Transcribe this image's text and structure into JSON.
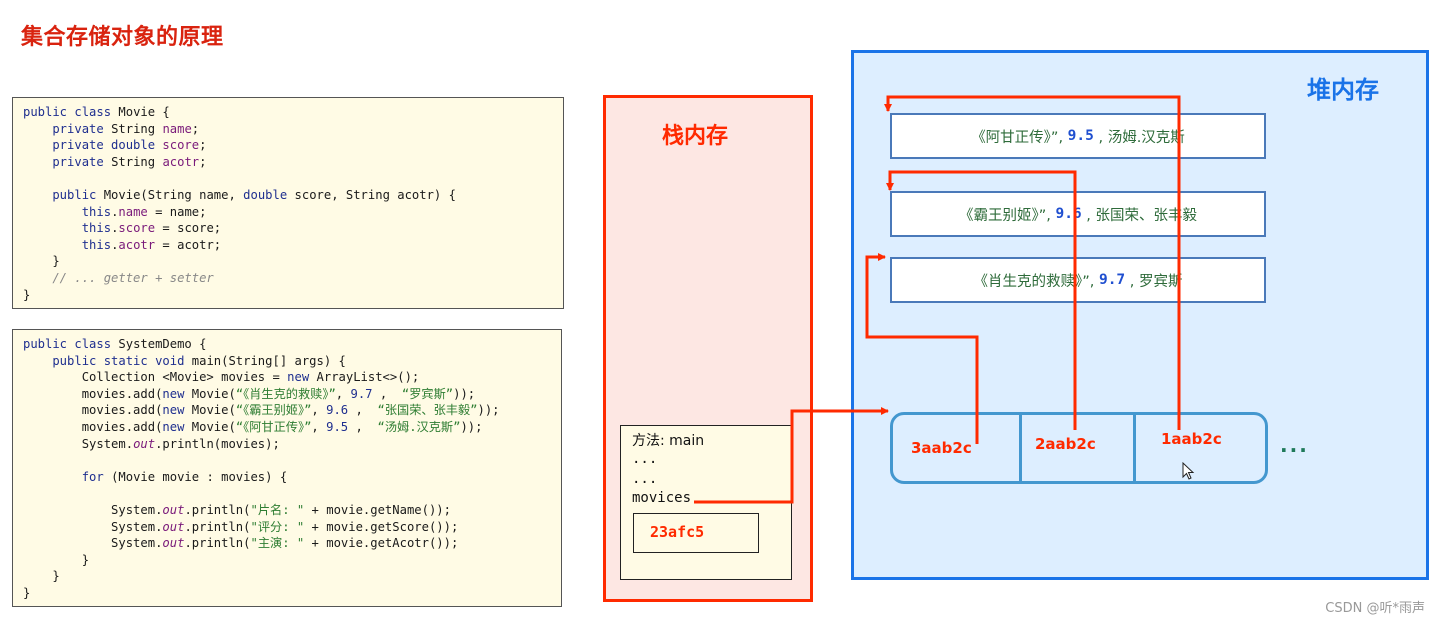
{
  "title": "集合存储对象的原理",
  "code_movie": [
    [
      {
        "t": "public class ",
        "c": "kw"
      },
      {
        "t": "Movie {",
        "c": ""
      }
    ],
    [
      {
        "t": "    private ",
        "c": "kw"
      },
      {
        "t": "String ",
        "c": ""
      },
      {
        "t": "name",
        "c": "fld"
      },
      {
        "t": ";",
        "c": ""
      }
    ],
    [
      {
        "t": "    private double ",
        "c": "kw"
      },
      {
        "t": "score",
        "c": "fld"
      },
      {
        "t": ";",
        "c": ""
      }
    ],
    [
      {
        "t": "    private ",
        "c": "kw"
      },
      {
        "t": "String ",
        "c": ""
      },
      {
        "t": "acotr",
        "c": "fld"
      },
      {
        "t": ";",
        "c": ""
      }
    ],
    [
      {
        "t": "",
        "c": ""
      }
    ],
    [
      {
        "t": "    public ",
        "c": "kw"
      },
      {
        "t": "Movie(String name, ",
        "c": ""
      },
      {
        "t": "double ",
        "c": "kw"
      },
      {
        "t": "score, String acotr) {",
        "c": ""
      }
    ],
    [
      {
        "t": "        this",
        "c": "kw"
      },
      {
        "t": ".",
        "c": ""
      },
      {
        "t": "name",
        "c": "fld"
      },
      {
        "t": " = name;",
        "c": ""
      }
    ],
    [
      {
        "t": "        this",
        "c": "kw"
      },
      {
        "t": ".",
        "c": ""
      },
      {
        "t": "score",
        "c": "fld"
      },
      {
        "t": " = score;",
        "c": ""
      }
    ],
    [
      {
        "t": "        this",
        "c": "kw"
      },
      {
        "t": ".",
        "c": ""
      },
      {
        "t": "acotr",
        "c": "fld"
      },
      {
        "t": " = acotr;",
        "c": ""
      }
    ],
    [
      {
        "t": "    }",
        "c": ""
      }
    ],
    [
      {
        "t": "    // ... getter + setter",
        "c": "cmt"
      }
    ],
    [
      {
        "t": "}",
        "c": ""
      }
    ]
  ],
  "code_demo": [
    [
      {
        "t": "public class ",
        "c": "kw"
      },
      {
        "t": "SystemDemo {",
        "c": ""
      }
    ],
    [
      {
        "t": "    public static void ",
        "c": "kw"
      },
      {
        "t": "main(String[] args) {",
        "c": ""
      }
    ],
    [
      {
        "t": "        Collection <Movie> movies = ",
        "c": ""
      },
      {
        "t": "new ",
        "c": "kw"
      },
      {
        "t": "ArrayList<>();",
        "c": ""
      }
    ],
    [
      {
        "t": "        movies.add(",
        "c": ""
      },
      {
        "t": "new ",
        "c": "kw"
      },
      {
        "t": "Movie(",
        "c": ""
      },
      {
        "t": "“《肖生克的救赎》”",
        "c": "str"
      },
      {
        "t": ", ",
        "c": ""
      },
      {
        "t": "9.7",
        "c": "num"
      },
      {
        "t": " ,  ",
        "c": ""
      },
      {
        "t": "“罗宾斯”",
        "c": "str"
      },
      {
        "t": "));",
        "c": ""
      }
    ],
    [
      {
        "t": "        movies.add(",
        "c": ""
      },
      {
        "t": "new ",
        "c": "kw"
      },
      {
        "t": "Movie(",
        "c": ""
      },
      {
        "t": "“《霸王别姬》”",
        "c": "str"
      },
      {
        "t": ", ",
        "c": ""
      },
      {
        "t": "9.6",
        "c": "num"
      },
      {
        "t": " ,  ",
        "c": ""
      },
      {
        "t": "“张国荣、张丰毅”",
        "c": "str"
      },
      {
        "t": "));",
        "c": ""
      }
    ],
    [
      {
        "t": "        movies.add(",
        "c": ""
      },
      {
        "t": "new ",
        "c": "kw"
      },
      {
        "t": "Movie(",
        "c": ""
      },
      {
        "t": "“《阿甘正传》”",
        "c": "str"
      },
      {
        "t": ", ",
        "c": ""
      },
      {
        "t": "9.5",
        "c": "num"
      },
      {
        "t": " ,  ",
        "c": ""
      },
      {
        "t": "“汤姆.汉克斯”",
        "c": "str"
      },
      {
        "t": "));",
        "c": ""
      }
    ],
    [
      {
        "t": "        System.",
        "c": ""
      },
      {
        "t": "out",
        "c": "it"
      },
      {
        "t": ".println(movies);",
        "c": ""
      }
    ],
    [
      {
        "t": "",
        "c": ""
      }
    ],
    [
      {
        "t": "        for ",
        "c": "kw"
      },
      {
        "t": "(Movie movie : movies) {",
        "c": ""
      }
    ],
    [
      {
        "t": "",
        "c": ""
      }
    ],
    [
      {
        "t": "            System.",
        "c": ""
      },
      {
        "t": "out",
        "c": "it"
      },
      {
        "t": ".println(",
        "c": ""
      },
      {
        "t": "\"片名: \"",
        "c": "str"
      },
      {
        "t": " + movie.getName());",
        "c": ""
      }
    ],
    [
      {
        "t": "            System.",
        "c": ""
      },
      {
        "t": "out",
        "c": "it"
      },
      {
        "t": ".println(",
        "c": ""
      },
      {
        "t": "\"评分: \"",
        "c": "str"
      },
      {
        "t": " + movie.getScore());",
        "c": ""
      }
    ],
    [
      {
        "t": "            System.",
        "c": ""
      },
      {
        "t": "out",
        "c": "it"
      },
      {
        "t": ".println(",
        "c": ""
      },
      {
        "t": "\"主演: \"",
        "c": "str"
      },
      {
        "t": " + movie.getAcotr());",
        "c": ""
      }
    ],
    [
      {
        "t": "        }",
        "c": ""
      }
    ],
    [
      {
        "t": "    }",
        "c": ""
      }
    ],
    [
      {
        "t": "}",
        "c": ""
      }
    ]
  ],
  "stack": {
    "title": "栈内存",
    "frame_method": "方法: main",
    "frame_dots1": "...",
    "frame_dots2": "...",
    "frame_var": "movices",
    "frame_ref": "23afc5"
  },
  "heap": {
    "title": "堆内存",
    "objects": [
      {
        "name": "《阿甘正传》”, ",
        "score": "9.5",
        "actor": " , 汤姆.汉克斯"
      },
      {
        "name": "《霸王别姬》”, ",
        "score": "9.6",
        "actor": " , 张国荣、张丰毅"
      },
      {
        "name": "《肖生克的救赎》”, ",
        "score": "9.7",
        "actor": " , 罗宾斯"
      }
    ],
    "list_cells": [
      "3aab2c",
      "2aab2c",
      "1aab2c"
    ],
    "list_more": "..."
  },
  "colors": {
    "title_red": "#d9230f",
    "arrow_red": "#ff2a00",
    "heap_blue": "#1a73e8",
    "stack_bg": "#fde7e3",
    "heap_bg": "#ddeeff"
  },
  "watermark": "CSDN @听*雨声"
}
